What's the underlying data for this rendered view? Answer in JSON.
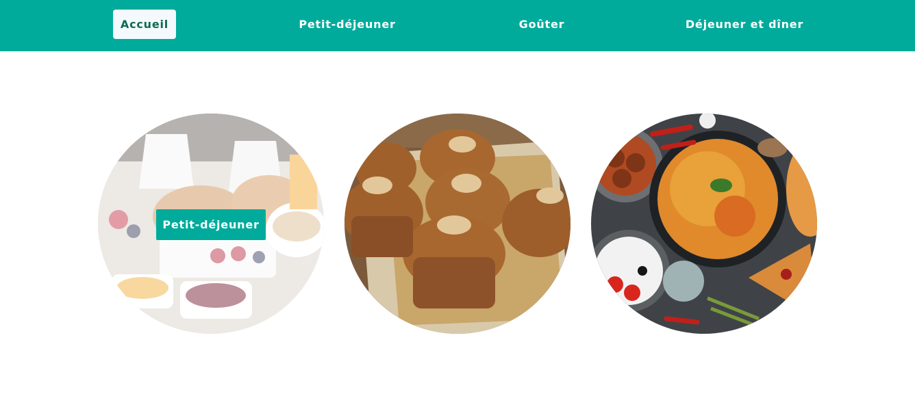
{
  "nav": {
    "items": [
      {
        "label": "Accueil",
        "active": true
      },
      {
        "label": "Petit-déjeuner",
        "active": false
      },
      {
        "label": "Goûter",
        "active": false
      },
      {
        "label": "Déjeuner et dîner",
        "active": false
      }
    ]
  },
  "categories": [
    {
      "image": "breakfast-pastries-image",
      "label": "Petit-déjeuner",
      "hovered": true
    },
    {
      "image": "banana-muffins-image"
    },
    {
      "image": "pasta-dinner-spread-image"
    }
  ],
  "colors": {
    "brand": "#00ab9c",
    "active_text": "#0e6a4e",
    "active_bg": "#f3f9fc"
  }
}
